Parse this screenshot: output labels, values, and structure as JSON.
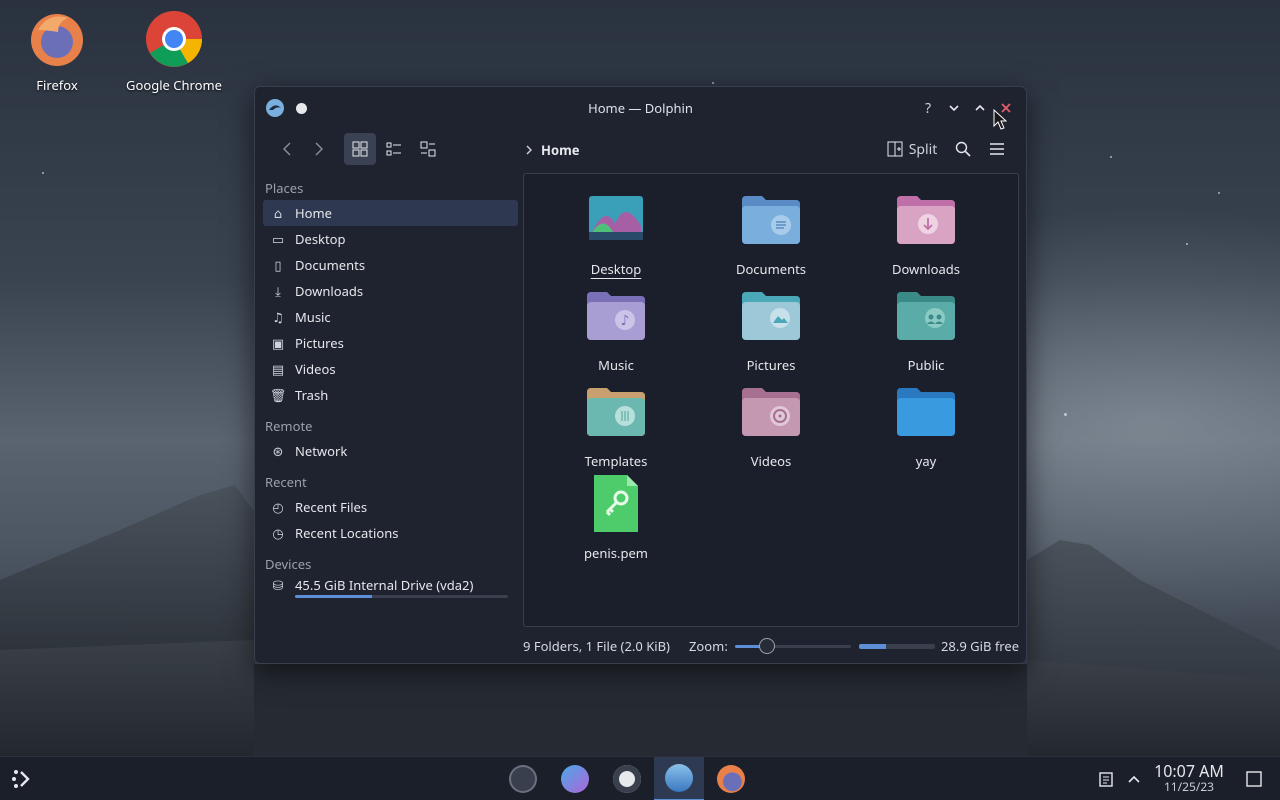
{
  "desktop": {
    "icons": [
      {
        "label": "Firefox"
      },
      {
        "label": "Google Chrome"
      }
    ]
  },
  "window": {
    "title": "Home — Dolphin",
    "toolbar": {
      "split_label": "Split",
      "breadcrumb": "Home"
    },
    "sidebar": {
      "sections": [
        {
          "title": "Places",
          "items": [
            "Home",
            "Desktop",
            "Documents",
            "Downloads",
            "Music",
            "Pictures",
            "Videos",
            "Trash"
          ]
        },
        {
          "title": "Remote",
          "items": [
            "Network"
          ]
        },
        {
          "title": "Recent",
          "items": [
            "Recent Files",
            "Recent Locations"
          ]
        },
        {
          "title": "Devices",
          "items": [
            "45.5 GiB Internal Drive (vda2)"
          ]
        }
      ],
      "selected": "Home",
      "drive_usage_fraction": 0.36
    },
    "files": [
      {
        "name": "Desktop",
        "type": "desktop"
      },
      {
        "name": "Documents",
        "type": "folder-docs"
      },
      {
        "name": "Downloads",
        "type": "folder-downloads"
      },
      {
        "name": "Music",
        "type": "folder-music"
      },
      {
        "name": "Pictures",
        "type": "folder-pictures"
      },
      {
        "name": "Public",
        "type": "folder-public"
      },
      {
        "name": "Templates",
        "type": "folder-templates"
      },
      {
        "name": "Videos",
        "type": "folder-videos"
      },
      {
        "name": "yay",
        "type": "folder-plain"
      },
      {
        "name": "penis.pem",
        "type": "key-file"
      }
    ],
    "status": {
      "summary": "9 Folders, 1 File (2.0 KiB)",
      "zoom_label": "Zoom:",
      "zoom_fraction": 0.28,
      "free_fraction": 0.36,
      "free_label": "28.9 GiB free"
    }
  },
  "taskbar": {
    "time": "10:07 AM",
    "date": "11/25/23"
  },
  "colors": {
    "accent": "#5c8fd6",
    "close": "#e35d6a",
    "window_bg": "#1f2330"
  }
}
